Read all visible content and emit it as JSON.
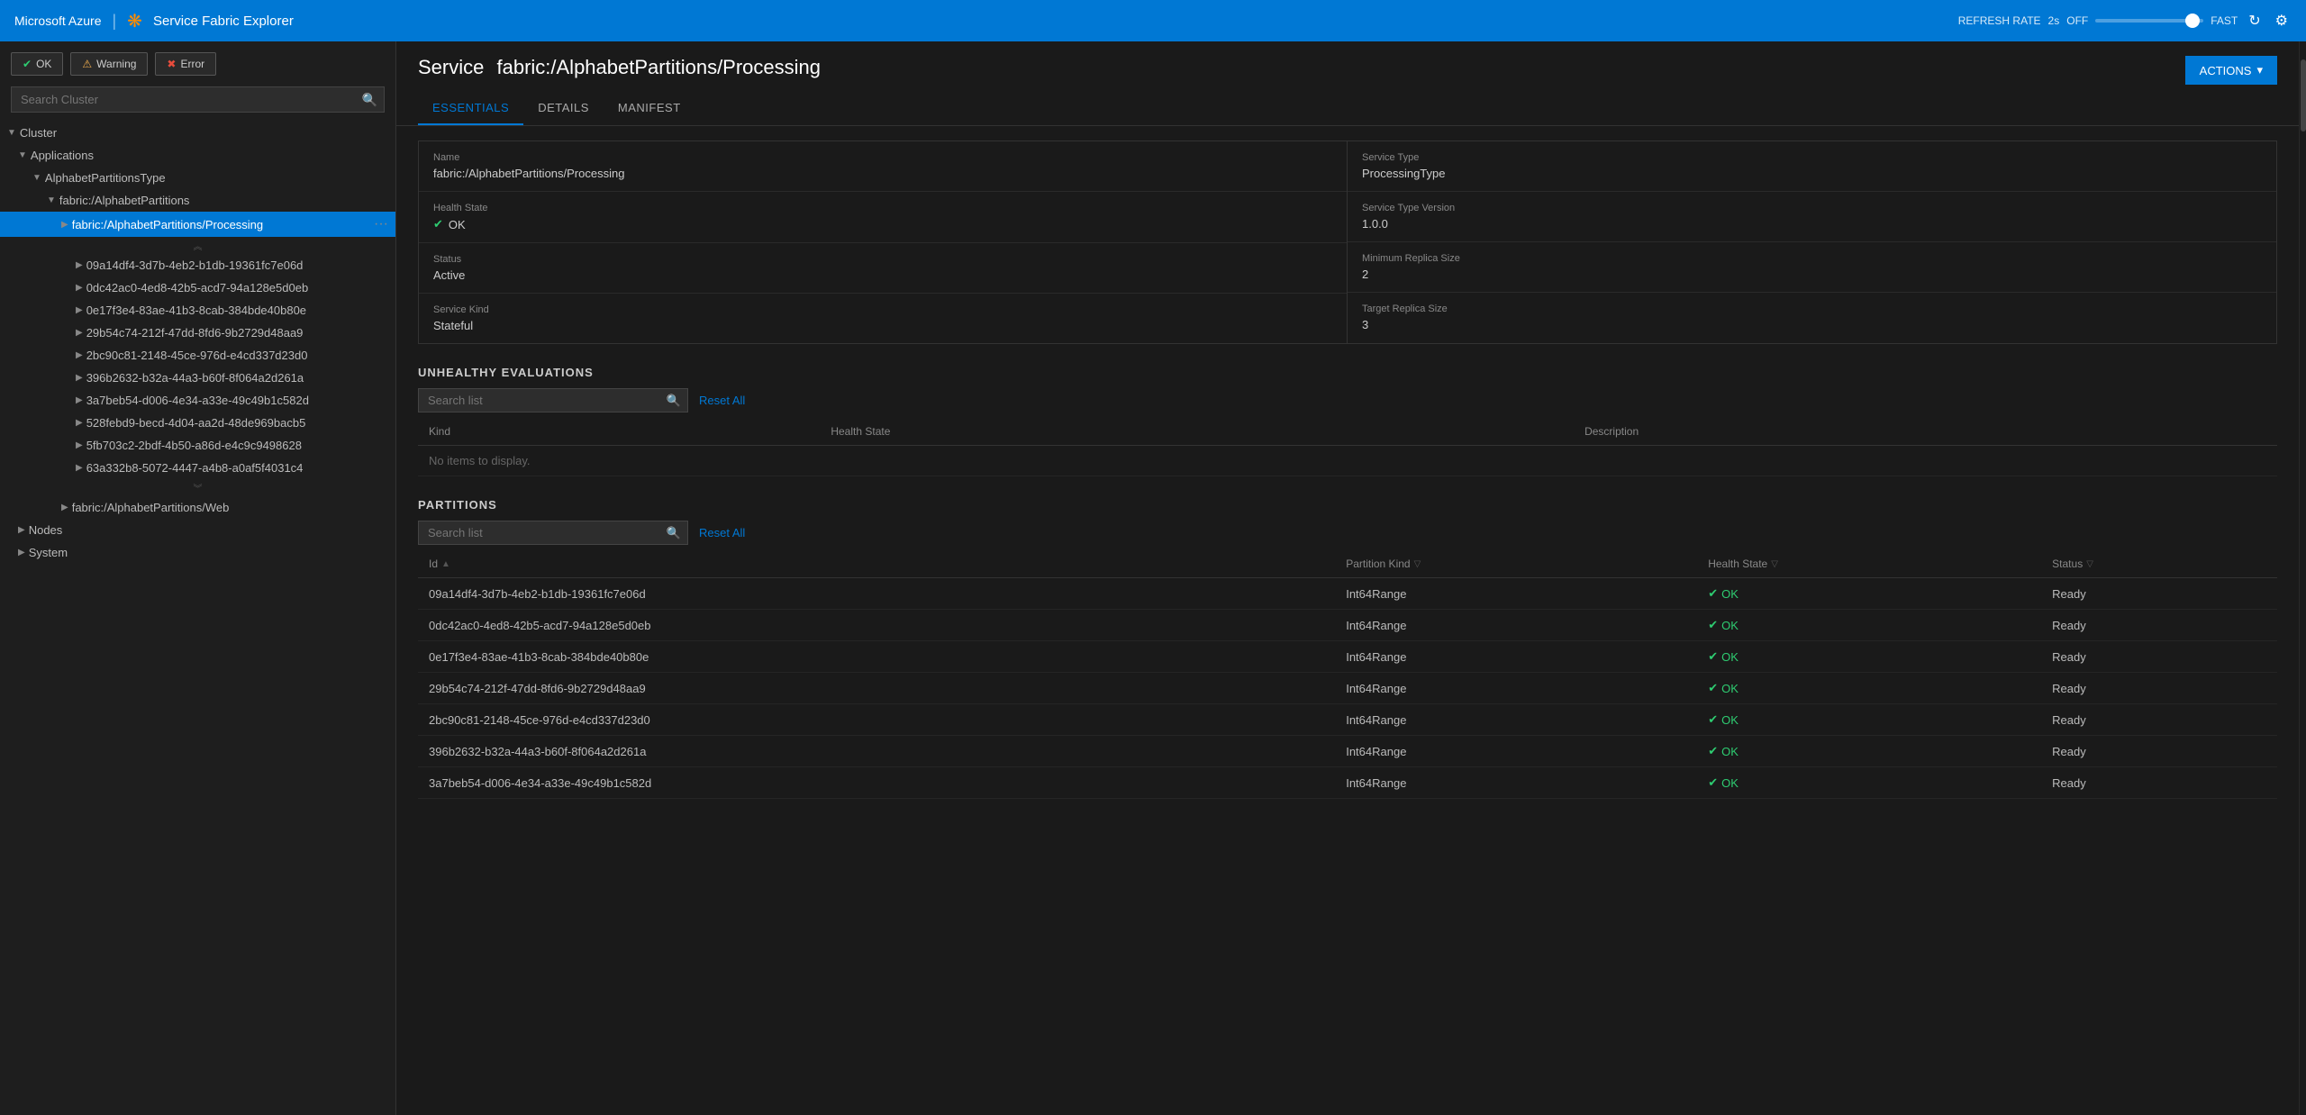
{
  "nav": {
    "brand": "Microsoft Azure",
    "separator": "|",
    "app_icon": "❋",
    "app_name": "Service Fabric Explorer",
    "refresh_label": "REFRESH RATE",
    "refresh_value": "2s",
    "off_label": "OFF",
    "fast_label": "FAST",
    "refresh_icon": "↻",
    "settings_icon": "⚙"
  },
  "sidebar": {
    "ok_label": "OK",
    "warning_label": "Warning",
    "error_label": "Error",
    "search_placeholder": "Search Cluster",
    "tree": [
      {
        "id": "cluster",
        "label": "Cluster",
        "level": 0,
        "expanded": true,
        "type": "header"
      },
      {
        "id": "applications",
        "label": "Applications",
        "level": 1,
        "expanded": true,
        "type": "group"
      },
      {
        "id": "alphabetpartitionstype",
        "label": "AlphabetPartitionsType",
        "level": 2,
        "expanded": true,
        "type": "group"
      },
      {
        "id": "fabricalphabetpartitions",
        "label": "fabric:/AlphabetPartitions",
        "level": 3,
        "expanded": true,
        "type": "group"
      },
      {
        "id": "fabricalphabetpartitionsprocessing",
        "label": "fabric:/AlphabetPartitions/Processing",
        "level": 4,
        "expanded": false,
        "type": "item",
        "active": true
      },
      {
        "id": "scroll-up",
        "type": "scroll"
      },
      {
        "id": "p1",
        "label": "09a14df4-3d7b-4eb2-b1db-19361fc7e06d",
        "level": 5,
        "type": "leaf"
      },
      {
        "id": "p2",
        "label": "0dc42ac0-4ed8-42b5-acd7-94a128e5d0eb",
        "level": 5,
        "type": "leaf"
      },
      {
        "id": "p3",
        "label": "0e17f3e4-83ae-41b3-8cab-384bde40b80e",
        "level": 5,
        "type": "leaf"
      },
      {
        "id": "p4",
        "label": "29b54c74-212f-47dd-8fd6-9b2729d48aa9",
        "level": 5,
        "type": "leaf"
      },
      {
        "id": "p5",
        "label": "2bc90c81-2148-45ce-976d-e4cd337d23d0",
        "level": 5,
        "type": "leaf"
      },
      {
        "id": "p6",
        "label": "396b2632-b32a-44a3-b60f-8f064a2d261a",
        "level": 5,
        "type": "leaf"
      },
      {
        "id": "p7",
        "label": "3a7beb54-d006-4e34-a33e-49c49b1c582d",
        "level": 5,
        "type": "leaf"
      },
      {
        "id": "p8",
        "label": "528febd9-becd-4d04-aa2d-48de969bacb5",
        "level": 5,
        "type": "leaf"
      },
      {
        "id": "p9",
        "label": "5fb703c2-2bdf-4b50-a86d-e4c9c9498628",
        "level": 5,
        "type": "leaf"
      },
      {
        "id": "p10",
        "label": "63a332b8-5072-4447-a4b8-a0af5f4031c4",
        "level": 5,
        "type": "leaf"
      },
      {
        "id": "scroll-down",
        "type": "scroll-down"
      },
      {
        "id": "fabricalphabetpartitionsweb",
        "label": "fabric:/AlphabetPartitions/Web",
        "level": 4,
        "expanded": false,
        "type": "item"
      },
      {
        "id": "nodes",
        "label": "Nodes",
        "level": 1,
        "expanded": false,
        "type": "group"
      },
      {
        "id": "system",
        "label": "System",
        "level": 1,
        "expanded": false,
        "type": "group"
      }
    ]
  },
  "content": {
    "service_label": "Service",
    "service_name": "fabric:/AlphabetPartitions/Processing",
    "actions_label": "ACTIONS",
    "tabs": [
      {
        "id": "essentials",
        "label": "ESSENTIALS",
        "active": true
      },
      {
        "id": "details",
        "label": "DETAILS",
        "active": false
      },
      {
        "id": "manifest",
        "label": "MANIFEST",
        "active": false
      }
    ],
    "essentials": {
      "name_label": "Name",
      "name_value": "fabric:/AlphabetPartitions/Processing",
      "health_state_label": "Health State",
      "health_state_value": "OK",
      "status_label": "Status",
      "status_value": "Active",
      "service_kind_label": "Service Kind",
      "service_kind_value": "Stateful",
      "service_type_label": "Service Type",
      "service_type_value": "ProcessingType",
      "service_type_version_label": "Service Type Version",
      "service_type_version_value": "1.0.0",
      "min_replica_label": "Minimum Replica Size",
      "min_replica_value": "2",
      "target_replica_label": "Target Replica Size",
      "target_replica_value": "3"
    },
    "unhealthy_section": {
      "title": "UNHEALTHY EVALUATIONS",
      "search_placeholder": "Search list",
      "reset_label": "Reset All",
      "columns": [
        {
          "id": "kind",
          "label": "Kind"
        },
        {
          "id": "health_state",
          "label": "Health State"
        },
        {
          "id": "description",
          "label": "Description"
        }
      ],
      "empty_message": "No items to display.",
      "rows": []
    },
    "partitions_section": {
      "title": "PARTITIONS",
      "search_placeholder": "Search list",
      "reset_label": "Reset All",
      "columns": [
        {
          "id": "id",
          "label": "Id",
          "sortable": true
        },
        {
          "id": "partition_kind",
          "label": "Partition Kind",
          "filterable": true
        },
        {
          "id": "health_state",
          "label": "Health State",
          "filterable": true
        },
        {
          "id": "status",
          "label": "Status",
          "filterable": true
        }
      ],
      "rows": [
        {
          "id": "09a14df4-3d7b-4eb2-b1db-19361fc7e06d",
          "partition_kind": "Int64Range",
          "health_state": "OK",
          "status": "Ready"
        },
        {
          "id": "0dc42ac0-4ed8-42b5-acd7-94a128e5d0eb",
          "partition_kind": "Int64Range",
          "health_state": "OK",
          "status": "Ready"
        },
        {
          "id": "0e17f3e4-83ae-41b3-8cab-384bde40b80e",
          "partition_kind": "Int64Range",
          "health_state": "OK",
          "status": "Ready"
        },
        {
          "id": "29b54c74-212f-47dd-8fd6-9b2729d48aa9",
          "partition_kind": "Int64Range",
          "health_state": "OK",
          "status": "Ready"
        },
        {
          "id": "2bc90c81-2148-45ce-976d-e4cd337d23d0",
          "partition_kind": "Int64Range",
          "health_state": "OK",
          "status": "Ready"
        },
        {
          "id": "396b2632-b32a-44a3-b60f-8f064a2d261a",
          "partition_kind": "Int64Range",
          "health_state": "OK",
          "status": "Ready"
        },
        {
          "id": "3a7beb54-d006-4e34-a33e-49c49b1c582d",
          "partition_kind": "Int64Range",
          "health_state": "OK",
          "status": "Ready"
        }
      ]
    }
  },
  "colors": {
    "ok": "#2ecc71",
    "warning": "#f0ad4e",
    "error": "#e74c3c",
    "link": "#4da6ff",
    "accent": "#0078d4"
  }
}
